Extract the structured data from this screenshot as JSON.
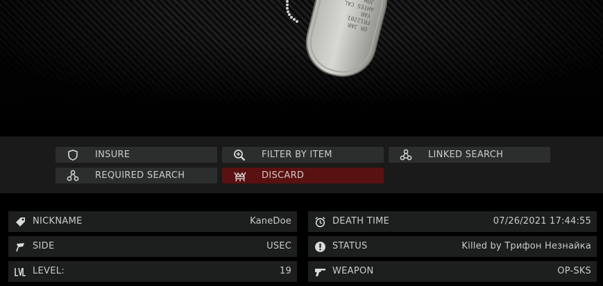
{
  "actions": {
    "insure": "INSURE",
    "filter_by_item": "FILTER BY ITEM",
    "linked_search": "LINKED SEARCH",
    "required_search": "REQUIRED SEARCH",
    "discard": "DISCARD"
  },
  "details": {
    "nickname": {
      "label": "NICKNAME",
      "value": "KaneDoe",
      "icon": "tag-icon"
    },
    "side": {
      "label": "SIDE",
      "value": "USEC",
      "icon": "flag-icon"
    },
    "level": {
      "label": "LEVEL:",
      "value": "19",
      "icon": "level-icon"
    },
    "death_time": {
      "label": "DEATH TIME",
      "value": "07/26/2021 17:44:55",
      "icon": "clock-icon"
    },
    "status": {
      "label": "STATUS",
      "value": "Killed by Трифон Незнайка",
      "icon": "exclamation-icon"
    },
    "weapon": {
      "label": "WEAPON",
      "value": "OP-SKS",
      "icon": "rifle-icon"
    }
  },
  "colors": {
    "discard_background": "#5a1111",
    "button_background": "#2b2e2d",
    "row_background": "#1d1e1e",
    "text": "#c9ccc8"
  }
}
